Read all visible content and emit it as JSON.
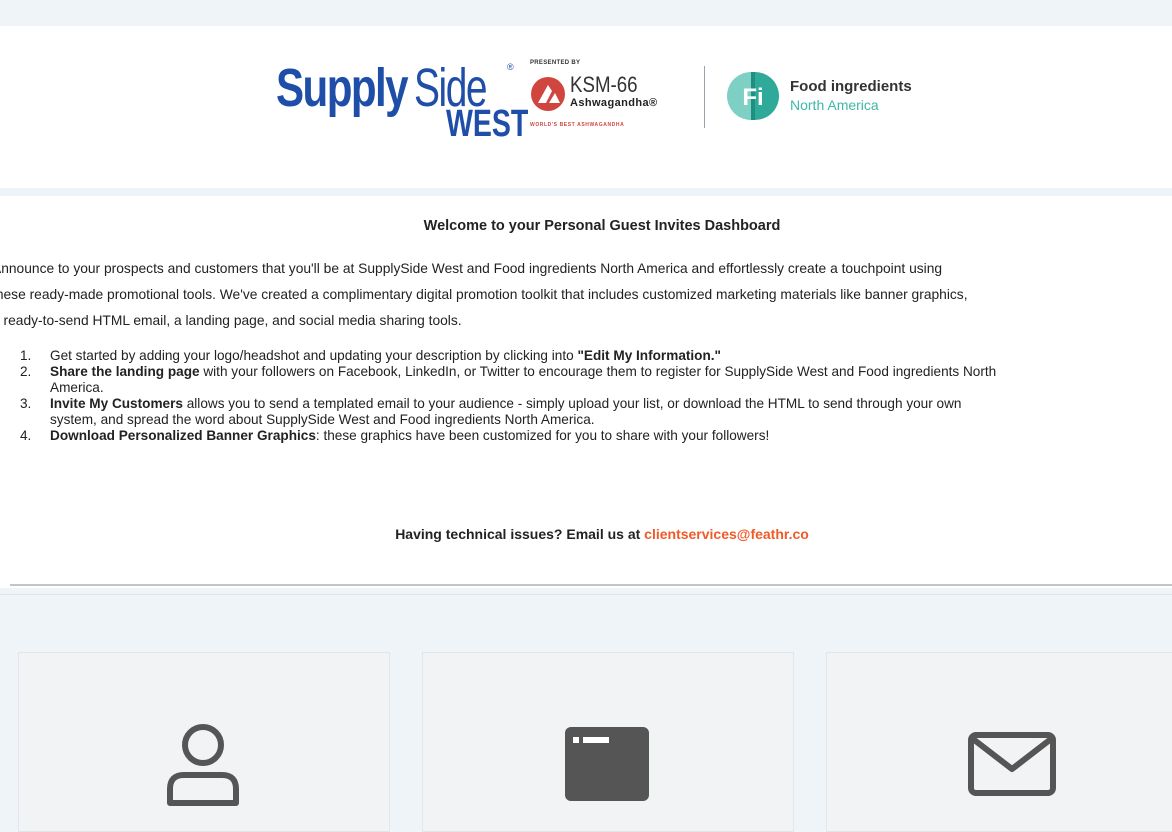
{
  "header": {
    "supplyside_logo": {
      "word1": "Supply",
      "word2": "Side",
      "word3": "WEST",
      "reg": "®"
    },
    "sponsor": {
      "presented_by": "PRESENTED BY",
      "name": "KSM-66",
      "sub": "Ashwagandha®",
      "tagline": "WORLD'S BEST ASHWAGANDHA"
    },
    "fi_logo": {
      "badge": "Fi",
      "name": "Food ingredients",
      "sub": "North America"
    }
  },
  "welcome": {
    "title": "Welcome to your Personal Guest Invites Dashboard",
    "intro_lines": [
      "Announce to your prospects and customers that you'll be at SupplySide West and Food ingredients North America and effortlessly create a touchpoint using",
      "these ready-made promotional tools. We've created a complimentary digital promotion toolkit that includes customized marketing materials like banner graphics,",
      "a ready-to-send HTML email, a landing page, and social media sharing tools."
    ],
    "steps": [
      {
        "num": "1.",
        "pre": "Get started by adding your logo/headshot and updating your description by clicking into ",
        "bold": "\"Edit My Information.\"",
        "post": "",
        "line2": ""
      },
      {
        "num": "2.",
        "pre": "",
        "bold": "Share the landing page",
        "post": " with your followers on Facebook, LinkedIn, or Twitter to encourage them to register for SupplySide West and Food ingredients North",
        "line2": "America."
      },
      {
        "num": "3.",
        "pre": "",
        "bold": "Invite My Customers",
        "post": " allows you to send a templated email to your audience - simply upload your list, or download the HTML to send through your own",
        "line2": "system, and spread the word about SupplySide West and Food ingredients North America."
      },
      {
        "num": "4.",
        "pre": "",
        "bold": "Download Personalized Banner Graphics",
        "post": ": these graphics have been customized for you to share with your followers!",
        "line2": ""
      }
    ],
    "tech_prefix": "Having technical issues? Email us at ",
    "tech_email": "clientservices@feathr.co"
  },
  "cards": [
    {
      "icon": "user-icon"
    },
    {
      "icon": "browser-window-icon"
    },
    {
      "icon": "envelope-icon"
    }
  ],
  "colors": {
    "supplyside_blue": "#1f4ea8",
    "ksm_red": "#d0463f",
    "fi_teal": "#3eb8a8",
    "link_orange": "#f05a28",
    "icon_gray": "#555555",
    "page_bg": "#eef4f8"
  }
}
